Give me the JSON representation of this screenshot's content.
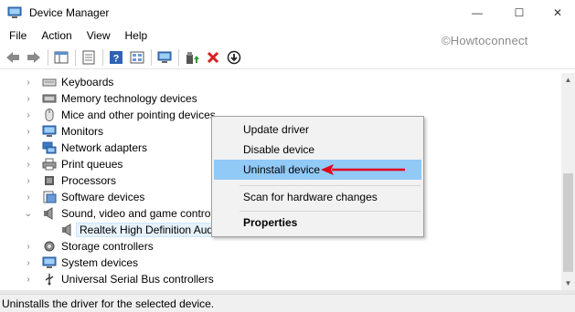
{
  "window": {
    "title": "Device Manager",
    "minimize_glyph": "—",
    "maximize_glyph": "☐",
    "close_glyph": "✕"
  },
  "menu": [
    "File",
    "Action",
    "View",
    "Help"
  ],
  "watermark": "©Howtoconnect",
  "toolbar": {
    "icons": [
      "back-arrow-icon",
      "forward-arrow-icon",
      "show-hide-console-tree-icon",
      "properties-icon",
      "help-icon",
      "scan-hardware-icon",
      "computer-icon",
      "update-driver-icon",
      "uninstall-icon",
      "disable-icon"
    ]
  },
  "tree": {
    "items": [
      {
        "label": "Keyboards",
        "expanded": false
      },
      {
        "label": "Memory technology devices",
        "expanded": false
      },
      {
        "label": "Mice and other pointing devices",
        "expanded": false
      },
      {
        "label": "Monitors",
        "expanded": false
      },
      {
        "label": "Network adapters",
        "expanded": false
      },
      {
        "label": "Print queues",
        "expanded": false
      },
      {
        "label": "Processors",
        "expanded": false
      },
      {
        "label": "Software devices",
        "expanded": false
      },
      {
        "label": "Sound, video and game controll",
        "expanded": true
      },
      {
        "label": "Realtek High Definition Audi",
        "child": true,
        "selected": true
      },
      {
        "label": "Storage controllers",
        "expanded": false
      },
      {
        "label": "System devices",
        "expanded": false
      },
      {
        "label": "Universal Serial Bus controllers",
        "expanded": false
      }
    ],
    "chevron_collapsed": "›",
    "chevron_expanded": "⌄"
  },
  "context_menu": {
    "items": [
      "Update driver",
      "Disable device",
      "Uninstall device",
      "Scan for hardware changes",
      "Properties"
    ],
    "highlighted": "Uninstall device",
    "arrow_color": "#e0001a"
  },
  "status": "Uninstalls the driver for the selected device.",
  "colors": {
    "highlight": "#91c9f7",
    "selection": "#e5f1fb"
  }
}
